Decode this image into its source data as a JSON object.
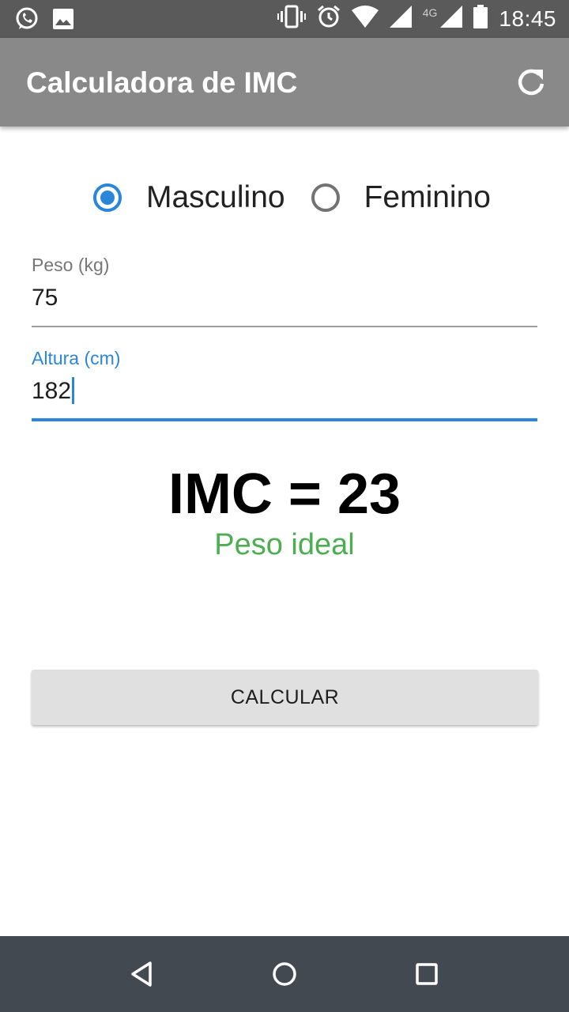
{
  "status_bar": {
    "time": "18:45",
    "network_type": "4G",
    "left_icons": [
      "whatsapp-icon",
      "gallery-icon"
    ],
    "right_icons": [
      "vibrate-icon",
      "alarm-icon",
      "wifi-icon",
      "signal-icon",
      "battery-icon"
    ]
  },
  "app_bar": {
    "title": "Calculadora de IMC",
    "action_icon": "refresh-icon"
  },
  "gender": {
    "options": [
      {
        "label": "Masculino",
        "selected": true
      },
      {
        "label": "Feminino",
        "selected": false
      }
    ]
  },
  "weight_field": {
    "label": "Peso (kg)",
    "value": "75"
  },
  "height_field": {
    "label": "Altura (cm)",
    "value": "182",
    "focused": true
  },
  "result": {
    "text": "IMC = 23",
    "status": "Peso ideal",
    "status_color": "#4cae50"
  },
  "calculate_button": {
    "label": "CALCULAR"
  },
  "nav_bar": {
    "buttons": [
      "back-icon",
      "home-icon",
      "recents-icon"
    ]
  },
  "colors": {
    "accent": "#2a86d9",
    "app_bar": "#898989",
    "status_bar": "#5a5a5a",
    "nav_bar": "#434951"
  }
}
